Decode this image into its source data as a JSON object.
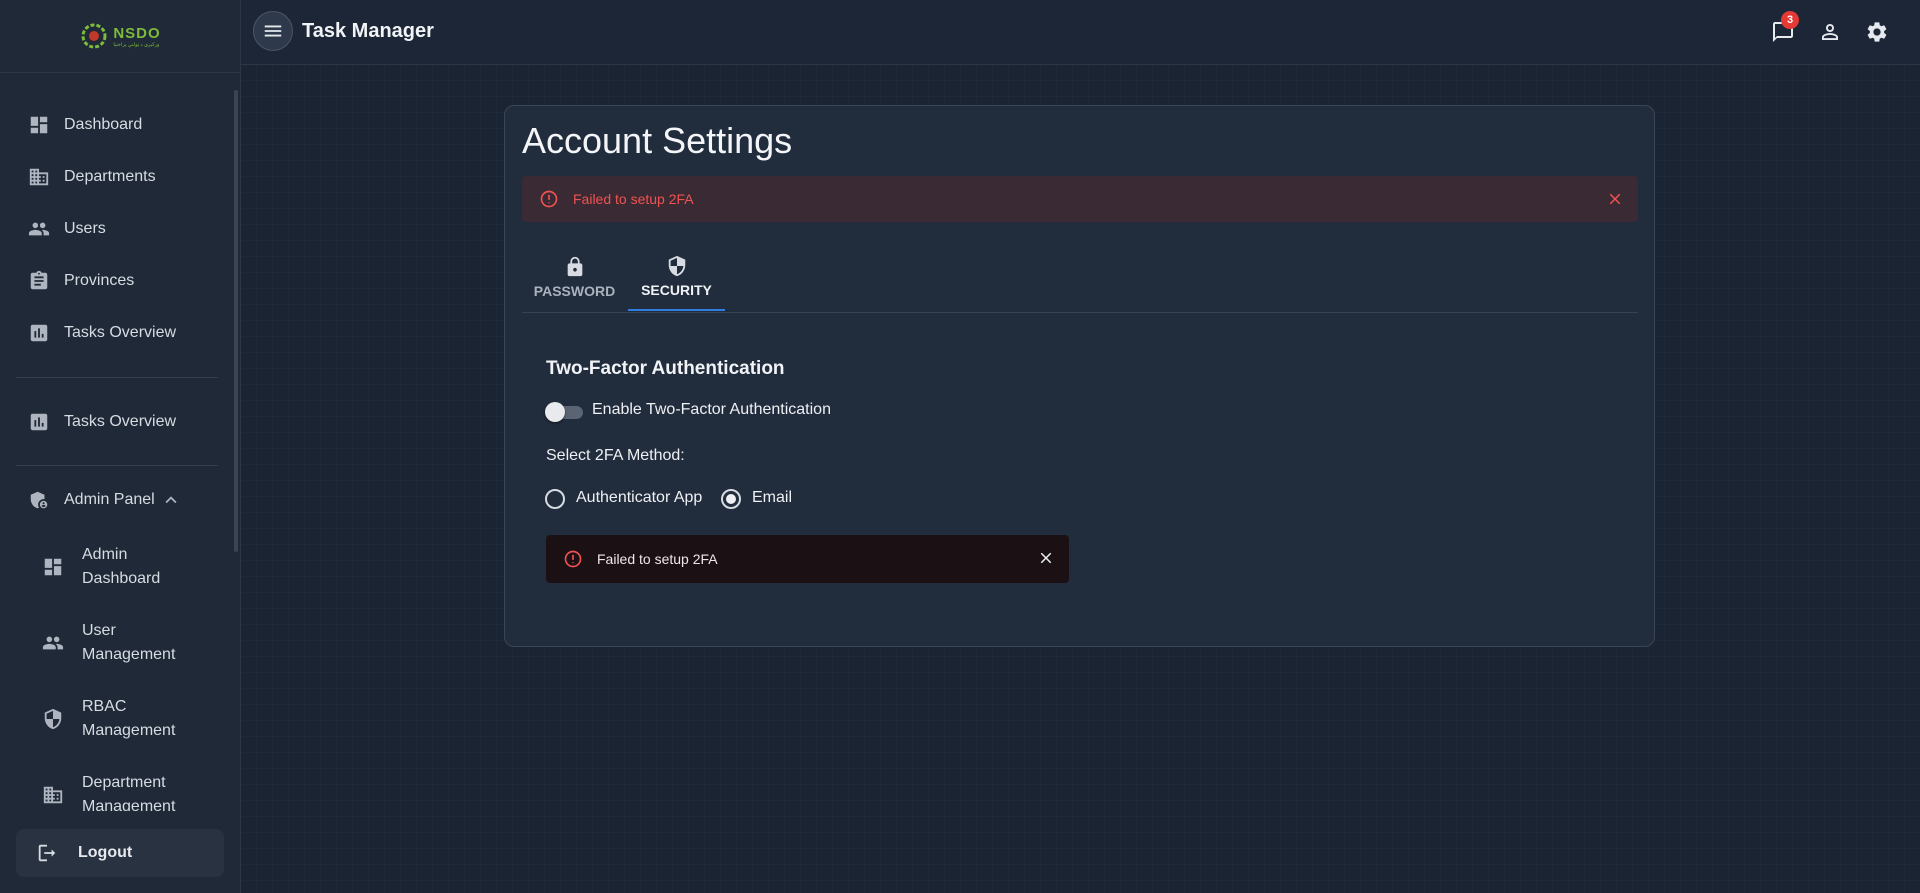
{
  "app": {
    "title": "Task Manager",
    "notification_count": "3"
  },
  "logo": {
    "text": "NSDO",
    "sub": "ورکیږي د ټولنې پراختیا"
  },
  "sidebar": {
    "items": [
      {
        "label": "Dashboard",
        "icon": "dashboard-icon"
      },
      {
        "label": "Departments",
        "icon": "building-icon"
      },
      {
        "label": "Users",
        "icon": "people-icon"
      },
      {
        "label": "Provinces",
        "icon": "clipboard-icon"
      },
      {
        "label": "Tasks Overview",
        "icon": "bar-chart-icon"
      }
    ],
    "secondary": [
      {
        "label": "Tasks Overview",
        "icon": "bar-chart-icon"
      }
    ],
    "admin_panel": {
      "label": "Admin Panel",
      "expanded": true,
      "items": [
        {
          "label": "Admin Dashboard"
        },
        {
          "label": "User Management"
        },
        {
          "label": "RBAC Management"
        },
        {
          "label": "Department Management"
        }
      ]
    },
    "logout_label": "Logout"
  },
  "page": {
    "title": "Account Settings",
    "alert_top": "Failed to setup 2FA",
    "tabs": [
      {
        "label": "PASSWORD",
        "icon": "lock-icon",
        "active": false
      },
      {
        "label": "SECURITY",
        "icon": "shield-icon",
        "active": true
      }
    ],
    "security": {
      "section_title": "Two-Factor Authentication",
      "enable_label": "Enable Two-Factor Authentication",
      "enabled": false,
      "method_label": "Select 2FA Method:",
      "methods": [
        {
          "label": "Authenticator App",
          "selected": false
        },
        {
          "label": "Email",
          "selected": true
        }
      ],
      "alert_inner": "Failed to setup 2FA"
    }
  },
  "colors": {
    "accent": "#2f7de1",
    "error": "#f05252",
    "badge": "#e53935"
  }
}
